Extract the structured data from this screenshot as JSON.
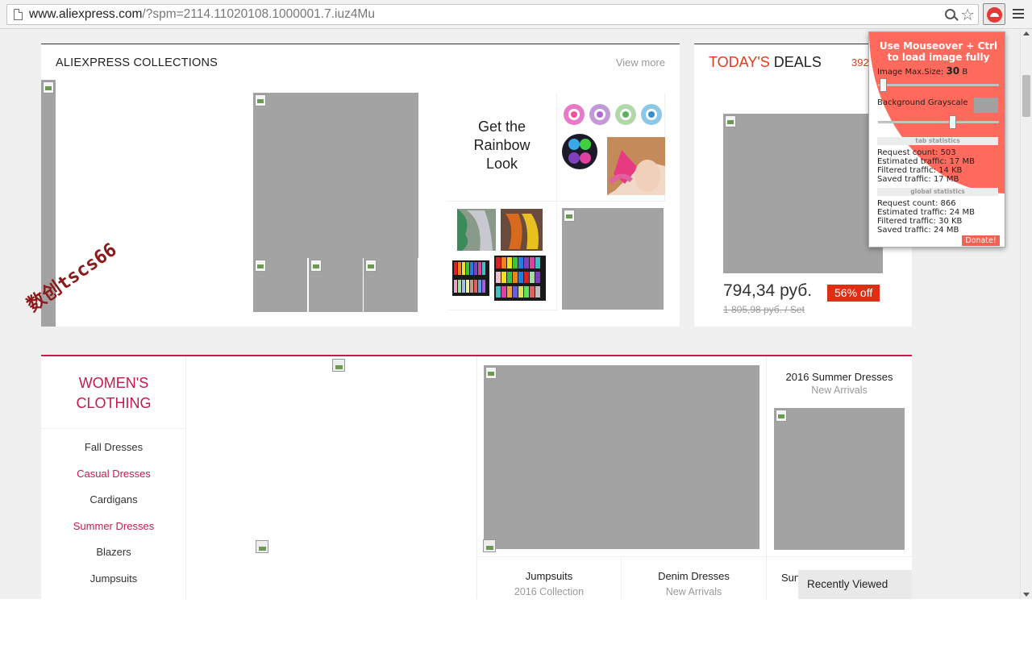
{
  "browser": {
    "url_host": "www.aliexpress.com",
    "url_rest": "/?spm=2114.11020108.1000001.7.iuz4Mu"
  },
  "collections": {
    "title_bold": "ALIEXPRESS",
    "title_rest": " COLLECTIONS",
    "view_more": "View more",
    "tile_text": [
      "Get the",
      "Rainbow",
      "Look"
    ],
    "watermark": "数创tscs66"
  },
  "deals": {
    "title_red": "TODAY'S",
    "title_rest": " DEALS",
    "count": "392",
    "price": "794,34 руб.",
    "discount": "56% off",
    "old_price": "1 805,98 руб. / Set"
  },
  "women": {
    "title_line1": "WOMEN'S",
    "title_line2": "CLOTHING",
    "categories": [
      {
        "label": "Fall Dresses"
      },
      {
        "label": "Casual Dresses"
      },
      {
        "label": "Cardigans"
      },
      {
        "label": "Summer Dresses"
      },
      {
        "label": "Blazers"
      },
      {
        "label": "Jumpsuits"
      }
    ],
    "cells": {
      "summer_title": "2016 Summer Dresses",
      "summer_sub": "New Arrivals",
      "jumpsuits_title": "Jumpsuits",
      "jumpsuits_sub": "2016 Collection",
      "denim_title": "Denim Dresses",
      "denim_sub": "New Arrivals",
      "partial_title": "Sun"
    }
  },
  "recently_viewed": "Recently Viewed",
  "popup": {
    "header": "Use Mouseover + Ctrl to load image fully",
    "max_size_label": "Image Max.Size: ",
    "max_size_value": "30",
    "max_size_unit": " B",
    "grayscale_label": "Background Grayscale",
    "tab_section": "tab statistics",
    "tab_request": "Request count: 503",
    "tab_estimated": "Estimated traffic: 17 MB",
    "tab_filtered": "Filtered traffic: 14 KB",
    "tab_saved": "Saved traffic: 17 MB",
    "global_section": "global statistics",
    "global_request": "Request count: 866",
    "global_estimated": "Estimated traffic: 24 MB",
    "global_filtered": "Filtered traffic: 30 KB",
    "global_saved": "Saved traffic: 24 MB",
    "donate": "Donate!"
  },
  "colors": {
    "accent_red": "#e03c1c",
    "women_accent": "#c51a4a",
    "popup_red": "#ff6a5c"
  }
}
